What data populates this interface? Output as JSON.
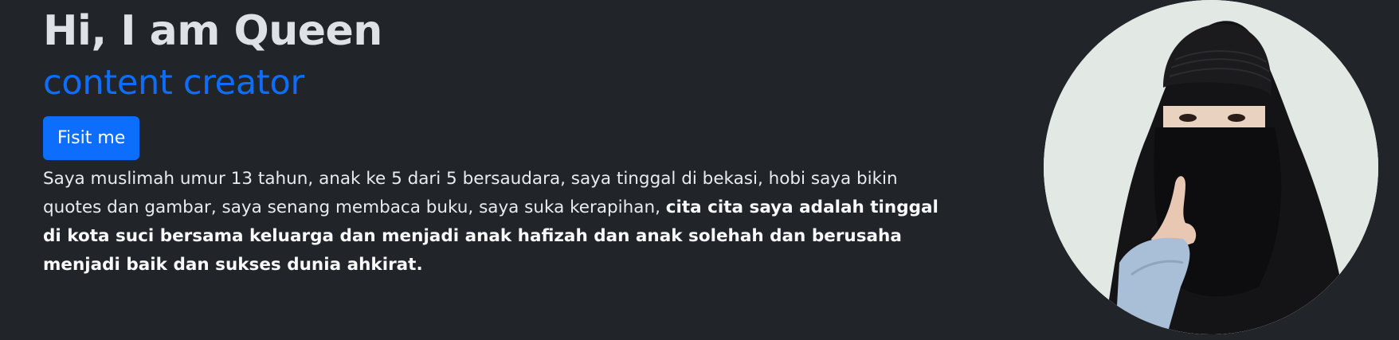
{
  "hero": {
    "greeting": "Hi, I am Queen",
    "role": "content creator",
    "button_label": "Fisit me",
    "bio_plain": "Saya muslimah umur 13 tahun, anak ke 5 dari 5 bersaudara, saya tinggal di bekasi, hobi saya bikin quotes dan gambar, saya senang membaca buku, saya suka kerapihan, ",
    "bio_bold": "cita cita saya adalah tinggal di kota suci bersama keluarga dan menjadi anak hafizah dan anak solehah dan berusaha menjadi baik dan sukses dunia ahkirat."
  },
  "avatar": {
    "icon": "profile-photo",
    "background_color": "#dfe7e2"
  },
  "colors": {
    "page_background": "#212529",
    "accent": "#0d6efd",
    "text": "#e9ecef"
  }
}
